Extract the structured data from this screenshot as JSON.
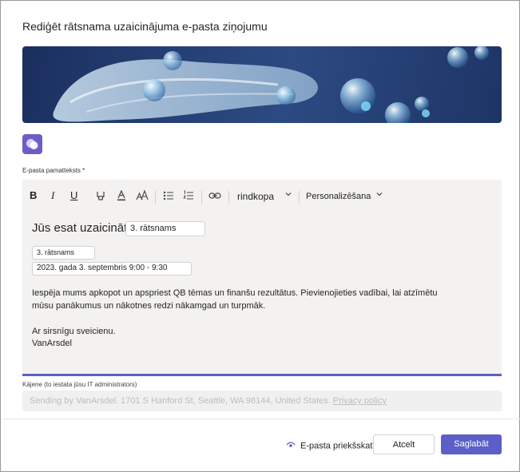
{
  "dialog": {
    "title": "Rediģēt rātsnama uzaicinājuma e-pasta ziņojumu"
  },
  "body_section": {
    "label": "E-pasta pamatteksts *",
    "toolbar": {
      "bold": "B",
      "italic": "I",
      "underline": "U",
      "font_style": "rindkopa",
      "personalize": "Personalizēšana"
    },
    "content": {
      "heading": "Jūs esat uzaicināts",
      "event_name_chip": "3. rātsnams",
      "event_title_chip": "3. rātsnams",
      "date_chip": "2023. gada 3. septembris 9:00 - 9:30",
      "paragraph_line1": "Iespēja mums apkopot un apspriest QB tēmas un finanšu rezultātus. Pievienojieties vadībai, lai atzīmētu",
      "paragraph_line2": "mūsu panākumus un nākotnes redzi nākamgad un turpmāk.",
      "signoff": "Ar sirsnīgu sveicienu.",
      "signature": "VanArsdel"
    }
  },
  "footer_section": {
    "label": "Kājene (to iestata jūsu IT administrators)",
    "text": "Sending by VanArsdel. 1701 S Hanford St, Seattle, WA 98144, United States.",
    "link": "Privacy policy"
  },
  "actions": {
    "preview": "E-pasta priekšskatījums",
    "cancel": "Atcelt",
    "save": "Saglabāt"
  },
  "colors": {
    "accent": "#5b5fc7",
    "editor_bg": "#f3f2f1"
  }
}
